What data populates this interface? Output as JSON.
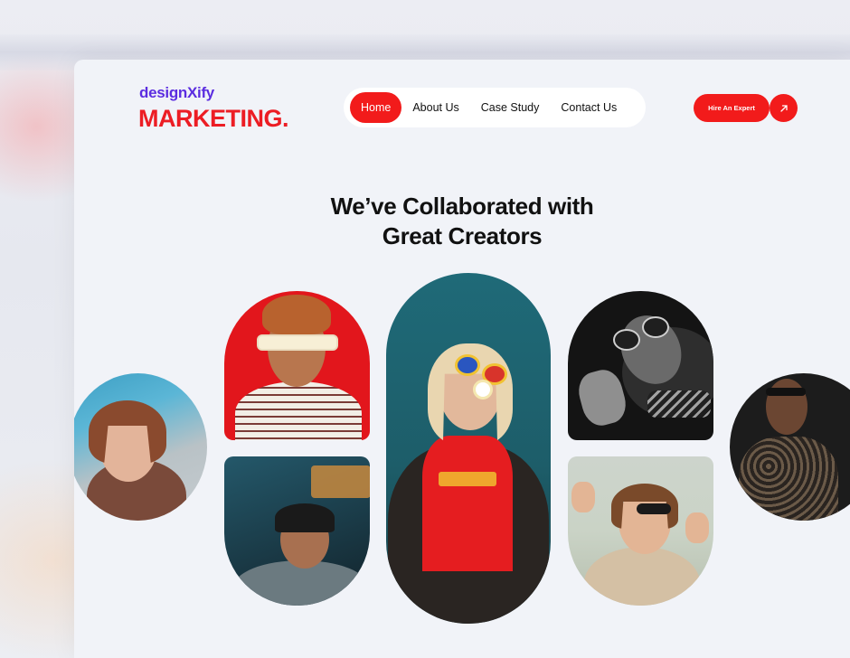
{
  "brand": {
    "top": "designXify",
    "main": "MARKETING."
  },
  "nav": {
    "items": [
      {
        "label": "Home",
        "active": true
      },
      {
        "label": "About Us",
        "active": false
      },
      {
        "label": "Case Study",
        "active": false
      },
      {
        "label": "Contact Us",
        "active": false
      }
    ]
  },
  "cta": {
    "hire_label": "Hire An Expert",
    "arrow_icon": "arrow-up-right-icon"
  },
  "section": {
    "heading_line1": "We’ve Collaborated with",
    "heading_line2": "Great Creators"
  },
  "colors": {
    "accent": "#f21b1b",
    "brand_purple": "#5b2de0",
    "brand_red": "#ec1d24",
    "page_bg": "#f1f3f8"
  }
}
